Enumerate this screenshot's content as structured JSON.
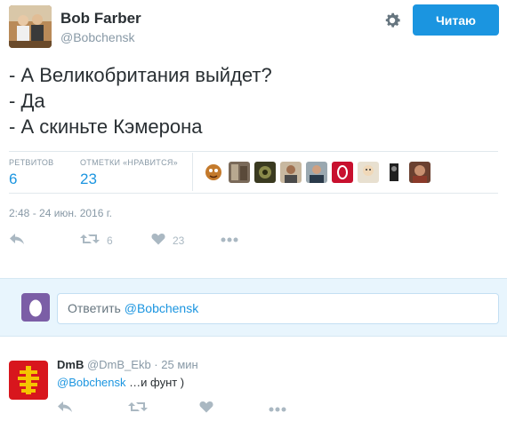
{
  "tweet": {
    "author_name": "Bob Farber",
    "author_handle": "@Bobchensk",
    "follow_label": "Читаю",
    "text_lines": [
      "- А Великобритания выйдет?",
      "- Да",
      "- А скиньте Кэмерона"
    ],
    "stats": {
      "retweets_label": "РЕТВИТОВ",
      "retweets_value": "6",
      "likes_label": "ОТМЕТКИ «НРАВИТСЯ»",
      "likes_value": "23"
    },
    "timestamp": "2:48 - 24 июн. 2016 г.",
    "actions": {
      "retweet_count": "6",
      "like_count": "23"
    }
  },
  "reply_box": {
    "prefix": "Ответить ",
    "mention": "@Bobchensk"
  },
  "reply_tweet": {
    "author_name": "DmB",
    "author_handle": "@DmB_Ekb",
    "separator": " · ",
    "time": "25 мин",
    "mention": "@Bobchensk",
    "text": " …и фунт )"
  },
  "colors": {
    "accent": "#1b95e0",
    "muted": "#8899a6",
    "reply_bg": "#e8f5fd"
  }
}
